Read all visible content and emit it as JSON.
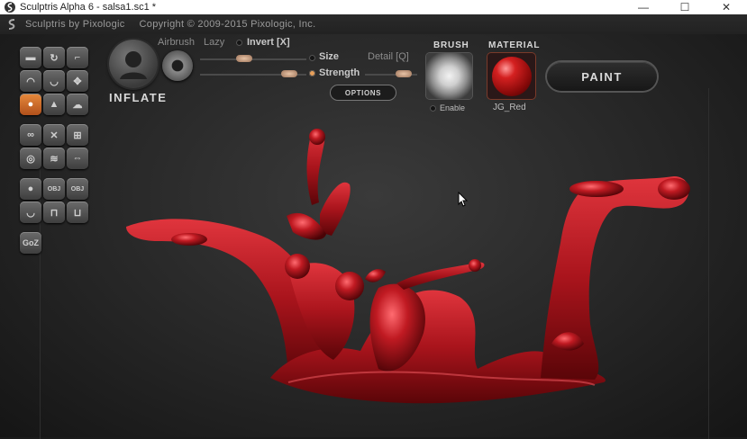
{
  "window": {
    "title": "Sculptris Alpha 6 - salsa1.sc1 *",
    "buttons": {
      "minimize": "—",
      "maximize": "☐",
      "close": "✕"
    }
  },
  "appbar": {
    "app_name": "Sculptris by Pixologic",
    "copyright": "Copyright © 2009-2015 Pixologic, Inc."
  },
  "tools": {
    "rows": [
      [
        "flatten-icon",
        "rotate-icon",
        "crease-icon"
      ],
      [
        "draw-icon",
        "smooth-icon",
        "grab-icon"
      ],
      [
        "inflate-icon",
        "pinch-icon",
        "flatten-cloud-icon"
      ],
      [
        "symmetry-icon",
        "mask-icon",
        "grid-icon"
      ],
      [
        "sphere-icon",
        "wave-icon",
        "move-arrows-icon"
      ],
      [
        "ball-icon",
        "obj-import-icon",
        "obj-export-icon"
      ],
      [
        "cup-icon",
        "lock-icon",
        "unlock-icon"
      ]
    ],
    "active": "inflate-icon",
    "goz_label": "GoZ",
    "obj_label": "OBJ"
  },
  "brush": {
    "name": "INFLATE",
    "airbrush_label": "Airbrush",
    "lazy_label": "Lazy",
    "invert_label": "Invert [X]",
    "size_label": "Size",
    "strength_label": "Strength",
    "detail_label": "Detail [Q]",
    "options_label": "OPTIONS",
    "size_value": 0.4,
    "strength_value": 0.9,
    "detail_value": 0.85
  },
  "brush_panel": {
    "title": "BRUSH",
    "enable_label": "Enable"
  },
  "material_panel": {
    "title": "MATERIAL",
    "name": "JG_Red"
  },
  "paint_button": "PAINT",
  "colors": {
    "accent": "#e07a32",
    "material": "#c0202a",
    "background": "#262626"
  }
}
